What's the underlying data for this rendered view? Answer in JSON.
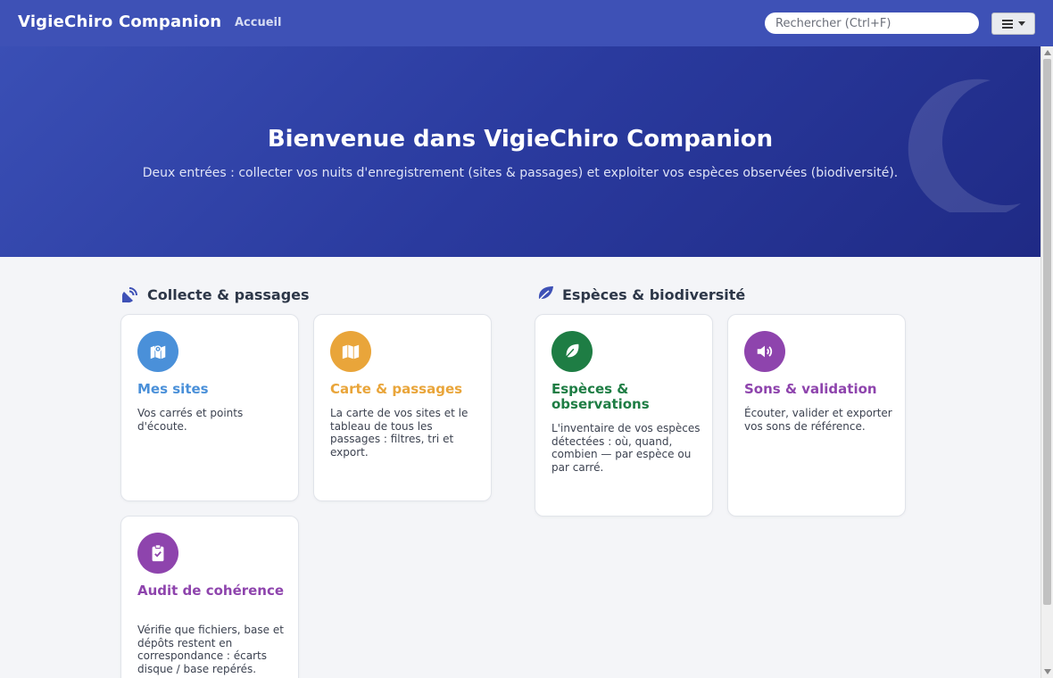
{
  "navbar": {
    "brand": "VigieChiro Companion",
    "home_link": "Accueil",
    "search_placeholder": "Rechercher (Ctrl+F)"
  },
  "hero": {
    "title": "Bienvenue dans VigieChiro Companion",
    "subtitle": "Deux entrées : collecter vos nuits d'enregistrement (sites & passages) et exploiter vos espèces observées (biodiversité)."
  },
  "sections": {
    "collecte": {
      "title": "Collecte & passages",
      "icon": "satellite-dish-icon",
      "cards": [
        {
          "title": "Mes sites",
          "desc": "Vos carrés et points d'écoute.",
          "color": "#4a90d9",
          "icon": "map-marker-icon"
        },
        {
          "title": "Carte & passages",
          "desc": "La carte de vos sites et le tableau de tous les passages : filtres, tri et export.",
          "color": "#e9a53a",
          "icon": "map-icon"
        },
        {
          "title": "Audit de cohérence",
          "desc": "Vérifie que fichiers, base et dépôts restent en correspondance : écarts disque / base repérés.",
          "color": "#8e44ad",
          "icon": "clipboard-check-icon"
        }
      ]
    },
    "especes": {
      "title": "Espèces & biodiversité",
      "icon": "leaf-icon",
      "cards": [
        {
          "title": "Espèces & observations",
          "desc": "L'inventaire de vos espèces détectées : où, quand, combien — par espèce ou par carré.",
          "color": "#1e7d44",
          "icon": "feather-icon"
        },
        {
          "title": "Sons & validation",
          "desc": "Écouter, valider et exporter vos sons de référence.",
          "color": "#8e44ad",
          "icon": "volume-icon"
        }
      ]
    }
  },
  "colors": {
    "navbar": "#3e51b6",
    "hero_start": "#3a4fb5",
    "hero_end": "#1f2a85",
    "section_collecte_icon": "#3e51b6",
    "section_especes_icon": "#3e51b6"
  }
}
